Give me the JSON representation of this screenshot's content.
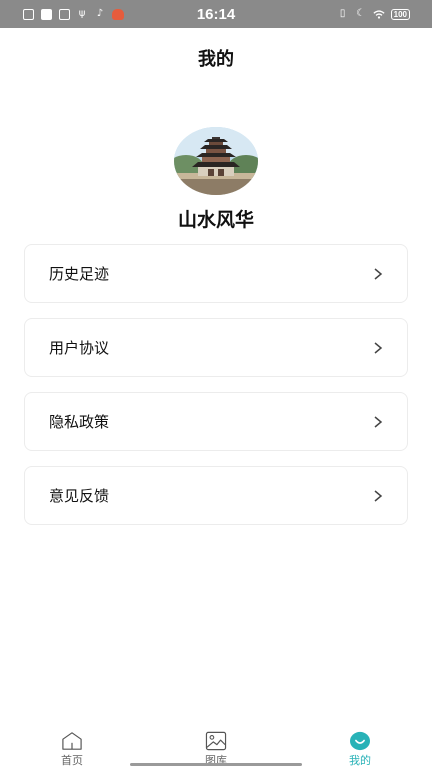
{
  "status_bar": {
    "time": "16:14",
    "battery": "100",
    "left_icons": [
      "file-icon",
      "mail-icon",
      "sim-icon",
      "usb-icon",
      "tiktok-icon",
      "app-icon"
    ],
    "right_icons": [
      "vibrate-icon",
      "moon-icon",
      "wifi-icon",
      "battery-icon"
    ]
  },
  "header": {
    "title": "我的"
  },
  "profile": {
    "name": "山水风华",
    "avatar": "pagoda-landscape-image"
  },
  "menu": {
    "items": [
      {
        "label": "历史足迹",
        "icon": "chevron-right-icon"
      },
      {
        "label": "用户协议",
        "icon": "chevron-right-icon"
      },
      {
        "label": "隐私政策",
        "icon": "chevron-right-icon"
      },
      {
        "label": "意见反馈",
        "icon": "chevron-right-icon"
      }
    ]
  },
  "bottom_nav": {
    "items": [
      {
        "label": "首页",
        "icon": "home-icon",
        "active": false
      },
      {
        "label": "图库",
        "icon": "gallery-icon",
        "active": false
      },
      {
        "label": "我的",
        "icon": "profile-smile-icon",
        "active": true
      }
    ]
  },
  "colors": {
    "accent": "#28b2b7",
    "status_bar": "#8a8a8a"
  }
}
